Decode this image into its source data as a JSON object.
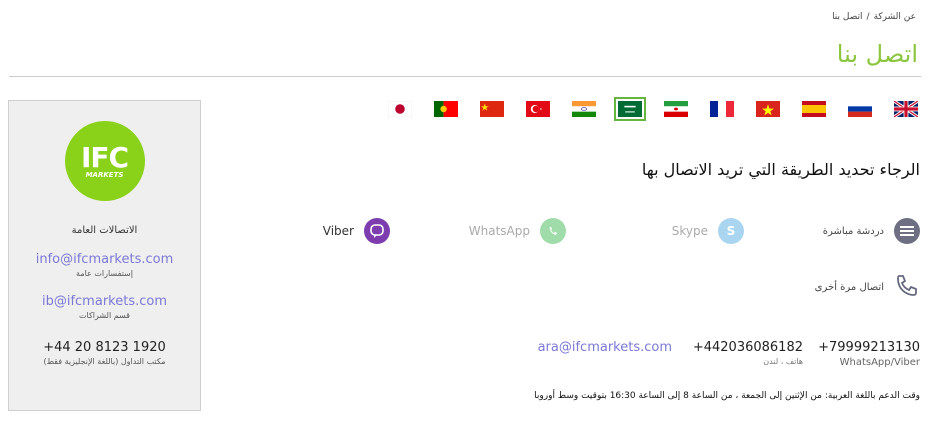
{
  "breadcrumb": {
    "item1": "عن الشركة",
    "separator": "/",
    "item2": "اتصل بنا"
  },
  "page_title": "اتصل بنا",
  "sidebar": {
    "logo_text": "IFC",
    "logo_sub": "MARKETS",
    "title": "الاتصالات العامة",
    "email1": "info@ifcmarkets.com",
    "email1_label": "إستفسارات عامة",
    "email2": "ib@ifcmarkets.com",
    "email2_label": "قسم الشراكات",
    "phone": "+44 20 8123 1920",
    "phone_label": "مكتب التداول (باللغة الإنجليزية فقط)"
  },
  "flags": [
    {
      "name": "uk",
      "active": false
    },
    {
      "name": "russia",
      "active": false
    },
    {
      "name": "spain",
      "active": false
    },
    {
      "name": "vietnam",
      "active": false
    },
    {
      "name": "france",
      "active": false
    },
    {
      "name": "iran",
      "active": false
    },
    {
      "name": "saudi-arabia",
      "active": true
    },
    {
      "name": "india",
      "active": false
    },
    {
      "name": "turkey",
      "active": false
    },
    {
      "name": "china",
      "active": false
    },
    {
      "name": "portugal",
      "active": false
    },
    {
      "name": "japan",
      "active": false
    }
  ],
  "instruction": "الرجاء تحديد الطريقة التي تريد الاتصال بها",
  "channels": {
    "chat": "دردشة مباشرة",
    "skype": "Skype",
    "whatsapp": "WhatsApp",
    "viber": "Viber"
  },
  "callback": "اتصال مرة أخرى",
  "contacts": {
    "phone1": "+79999213130",
    "phone1_label": "WhatsApp/Viber",
    "phone2": "+442036086182",
    "phone2_label": "هاتف ، لندن",
    "email": "ara@ifcmarkets.com"
  },
  "support_hours": "وقت الدعم باللغة العربية: من الإثنين إلى الجمعة ، من الساعة 8 إلى الساعة 16:30 بتوقيت وسط أوروبا",
  "colors": {
    "accent": "#8cc63f",
    "link": "#7b78d6",
    "viber": "#7d3daf",
    "whatsapp": "#25d366",
    "skype": "#00aff0"
  }
}
